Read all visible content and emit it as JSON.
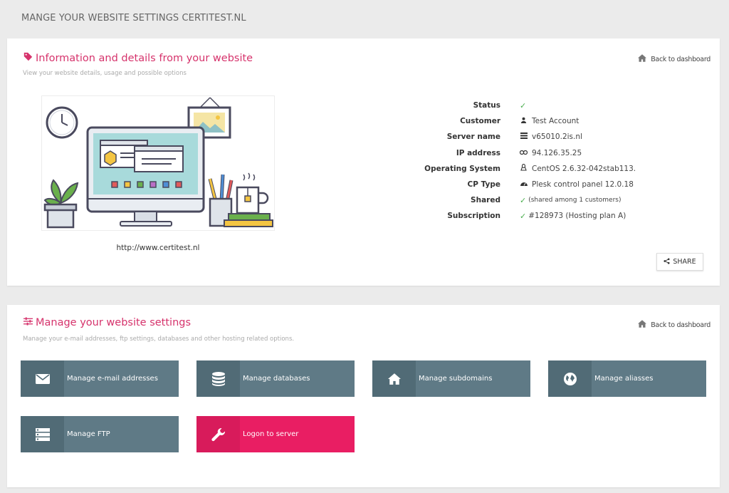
{
  "page_title": "MANGE YOUR WEBSITE SETTINGS CERTITEST.NL",
  "info_card": {
    "title": "Information and details from your website",
    "subtitle": "View your website details, usage and possible options",
    "back_label": "Back to dashboard",
    "site_url": "http://www.certitest.nl",
    "details": [
      {
        "label": "Status",
        "value": "",
        "icon": "check-icon"
      },
      {
        "label": "Customer",
        "value": "Test Account",
        "icon": "user-icon"
      },
      {
        "label": "Server name",
        "value": "v65010.2is.nl",
        "icon": "server-icon"
      },
      {
        "label": "IP address",
        "value": "94.126.35.25",
        "icon": "link-icon"
      },
      {
        "label": "Operating System",
        "value": "CentOS 2.6.32-042stab113.",
        "icon": "linux-icon"
      },
      {
        "label": "CP Type",
        "value": "Plesk control panel 12.0.18",
        "icon": "dashboard-icon"
      },
      {
        "label": "Shared",
        "value": "(shared among 1 customers)",
        "icon": "check-icon"
      },
      {
        "label": "Subscription",
        "value": "#128973 (Hosting plan A)",
        "icon": "check-icon"
      }
    ],
    "share_label": "SHARE"
  },
  "manage_card": {
    "title": "Manage your website settings",
    "subtitle": "Manage your e-mail addresses, ftp settings, databases and other hosting related options.",
    "back_label": "Back to dashboard",
    "tiles": [
      {
        "label": "Manage e-mail addresses",
        "icon": "envelope-icon"
      },
      {
        "label": "Manage databases",
        "icon": "database-icon"
      },
      {
        "label": "Manage subdomains",
        "icon": "home-icon"
      },
      {
        "label": "Manage aliasses",
        "icon": "globe-icon"
      },
      {
        "label": "Manage FTP",
        "icon": "server-icon"
      },
      {
        "label": "Logon to server",
        "icon": "wrench-icon"
      }
    ]
  },
  "colors": {
    "accent": "#d6336c",
    "tile": "#5f7a86",
    "tile_icon_bg": "#516b76",
    "tile_highlight": "#e91e63",
    "check": "#4caf50"
  }
}
